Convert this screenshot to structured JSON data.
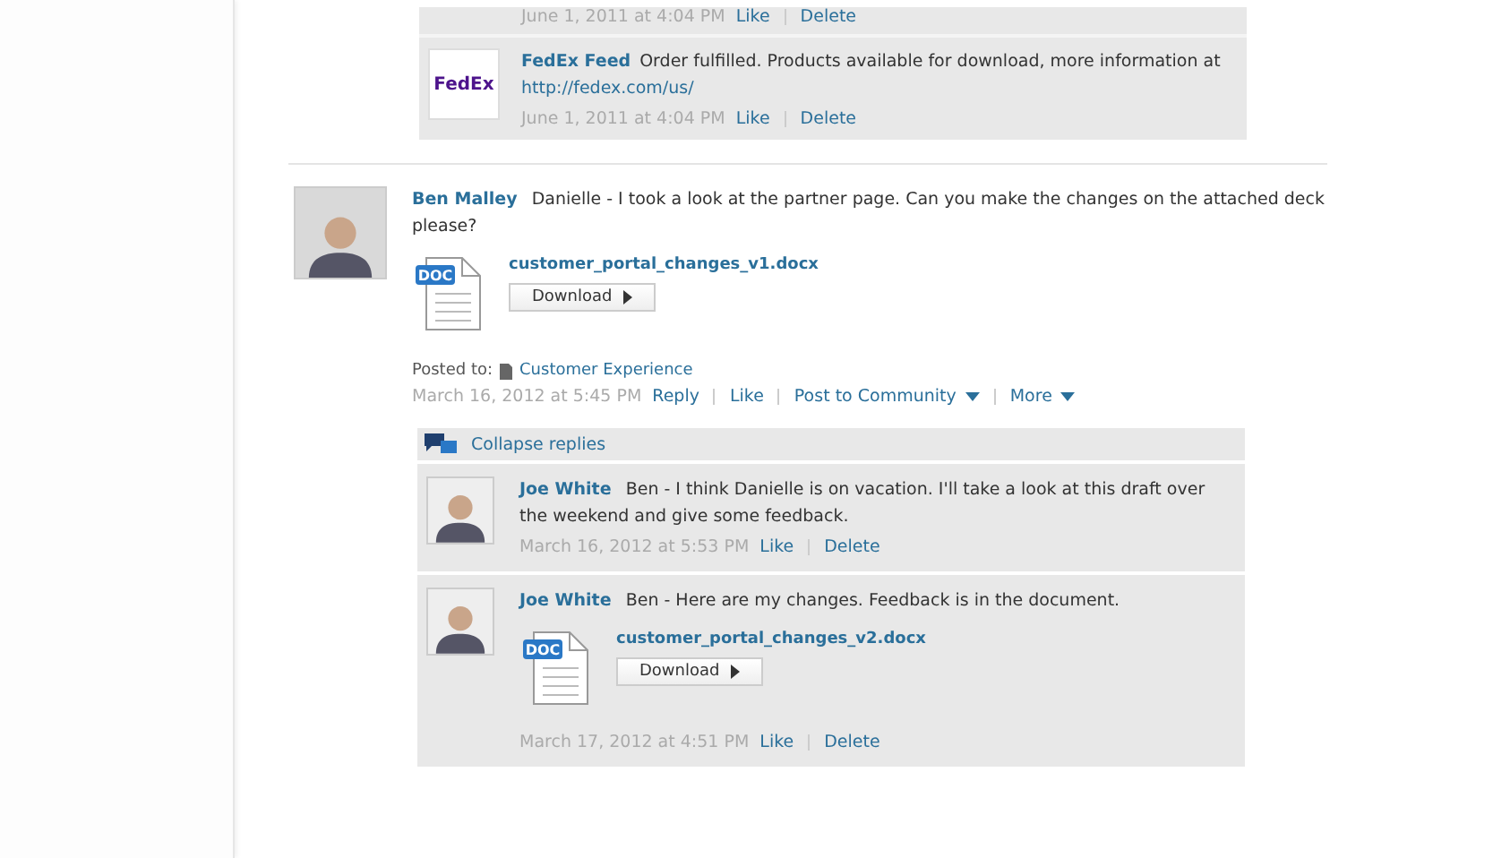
{
  "earlier_item": {
    "time": "June 1, 2011 at 4:04 PM",
    "actions": [
      "Like",
      "Delete"
    ]
  },
  "feed_item": {
    "logo": "FedEx",
    "author": "FedEx Feed",
    "text": "Order fulfilled. Products available for download, more information at",
    "link": "http://fedex.com/us/",
    "time": "June 1, 2011 at 4:04 PM",
    "actions": [
      "Like",
      "Delete"
    ]
  },
  "post": {
    "author": "Ben Malley",
    "text": "Danielle - I took a look at the partner page. Can you make the changes on the attached deck please?",
    "attachment": {
      "badge": "DOC",
      "filename": "customer_portal_changes_v1.docx",
      "button": "Download"
    },
    "posted_to_label": "Posted to:",
    "posted_to": "Customer Experience",
    "time": "March 16, 2012 at 5:45 PM",
    "actions": [
      {
        "label": "Reply",
        "dropdown": false
      },
      {
        "label": "Like",
        "dropdown": false
      },
      {
        "label": "Post to Community",
        "dropdown": true
      },
      {
        "label": "More",
        "dropdown": true
      }
    ]
  },
  "collapse_label": "Collapse replies",
  "replies": [
    {
      "author": "Joe White",
      "text": "Ben - I think Danielle is on vacation. I'll take a look at this draft over the weekend and give some feedback.",
      "time": "March 16, 2012 at 5:53 PM",
      "actions": [
        "Like",
        "Delete"
      ]
    },
    {
      "author": "Joe White",
      "text": "Ben - Here are my changes. Feedback is in the document.",
      "attachment": {
        "badge": "DOC",
        "filename": "customer_portal_changes_v2.docx",
        "button": "Download"
      },
      "time": "March 17, 2012 at 4:51 PM",
      "actions": [
        "Like",
        "Delete"
      ]
    }
  ]
}
